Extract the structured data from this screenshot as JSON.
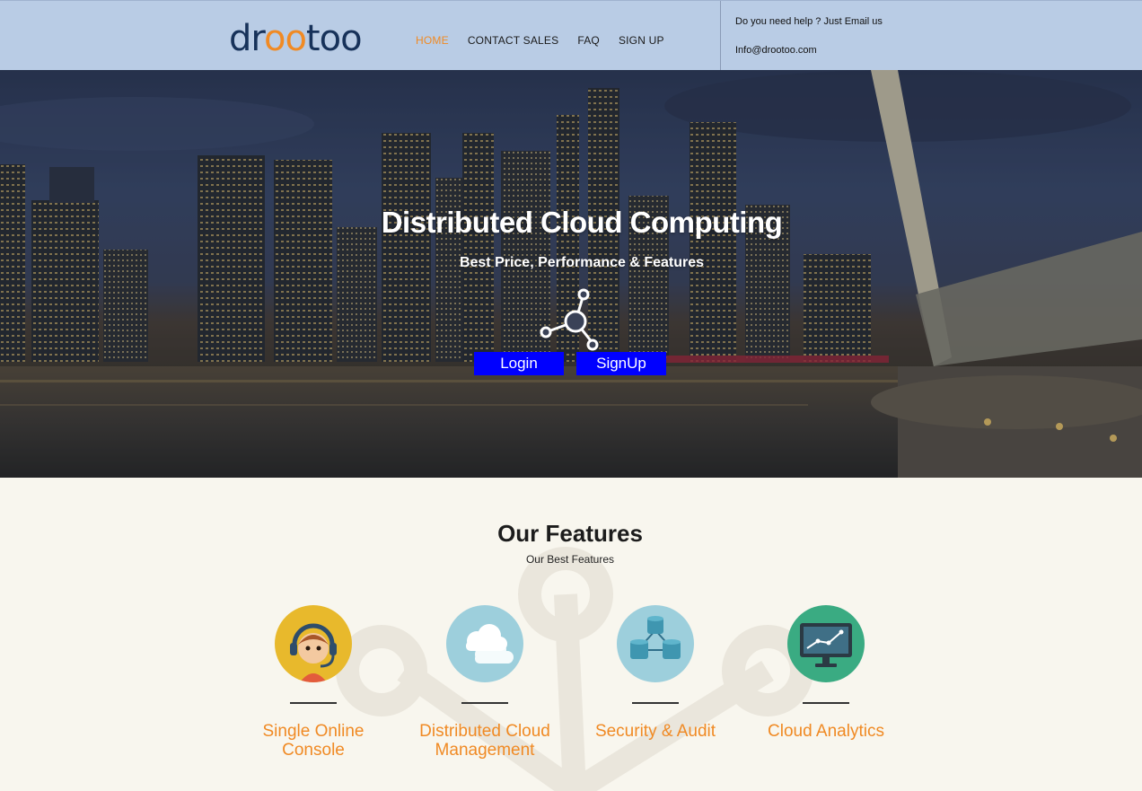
{
  "header": {
    "logo": {
      "part1": "dr",
      "part2": "oo",
      "part3": "too"
    },
    "nav": [
      "HOME",
      "CONTACT SALES",
      "FAQ",
      "SIGN UP"
    ],
    "help_line": "Do you need help ? Just Email us",
    "email": "Info@drootoo.com"
  },
  "hero": {
    "title": "Distributed Cloud Computing",
    "subtitle": "Best Price, Performance & Features",
    "login_label": "Login",
    "signup_label": "SignUp",
    "icon": "network-nodes-icon"
  },
  "features": {
    "title": "Our Features",
    "subtitle": "Our Best Features",
    "items": [
      {
        "label": "Single Online Console",
        "icon": "support-agent-icon",
        "color": "#e8b92c"
      },
      {
        "label": "Distributed Cloud Management",
        "icon": "cloud-icon",
        "color": "#9dcfdc"
      },
      {
        "label": "Security & Audit",
        "icon": "database-network-icon",
        "color": "#9dcfdc"
      },
      {
        "label": "Cloud Analytics",
        "icon": "monitor-chart-icon",
        "color": "#3aab82"
      }
    ]
  },
  "colors": {
    "accent": "#f08a24",
    "header_bg": "#b9cce5",
    "button": "#0000ff",
    "logo_dark": "#17325a"
  }
}
